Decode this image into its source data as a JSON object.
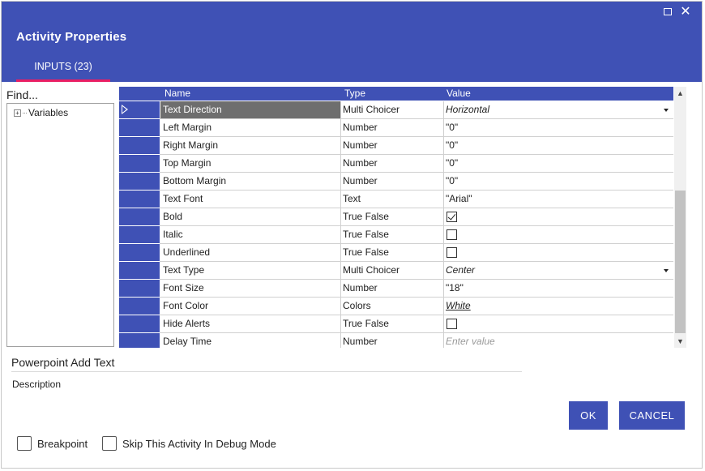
{
  "window": {
    "title": "Activity Properties",
    "maximize_icon": "maximize-icon",
    "close_icon": "close-icon",
    "close_glyph": "✕"
  },
  "tabs": [
    {
      "label": "INPUTS (23)",
      "active": true
    }
  ],
  "left_panel": {
    "find_label": "Find...",
    "tree": [
      {
        "label": "Variables",
        "expander": "+"
      }
    ]
  },
  "grid": {
    "headers": {
      "name": "Name",
      "type": "Type",
      "value": "Value"
    },
    "rows": [
      {
        "name": "Text Direction",
        "type": "Multi Choicer",
        "value": "Horizontal",
        "kind": "dropdown",
        "selected": true
      },
      {
        "name": "Left Margin",
        "type": "Number",
        "value": "\"0\"",
        "kind": "text"
      },
      {
        "name": "Right Margin",
        "type": "Number",
        "value": "\"0\"",
        "kind": "text"
      },
      {
        "name": "Top Margin",
        "type": "Number",
        "value": "\"0\"",
        "kind": "text"
      },
      {
        "name": "Bottom Margin",
        "type": "Number",
        "value": "\"0\"",
        "kind": "text"
      },
      {
        "name": "Text Font",
        "type": "Text",
        "value": "\"Arial\"",
        "kind": "text"
      },
      {
        "name": "Bold",
        "type": "True False",
        "checked": true,
        "kind": "checkbox"
      },
      {
        "name": "Italic",
        "type": "True False",
        "checked": false,
        "kind": "checkbox"
      },
      {
        "name": "Underlined",
        "type": "True False",
        "checked": false,
        "kind": "checkbox"
      },
      {
        "name": "Text Type",
        "type": "Multi Choicer",
        "value": "Center",
        "kind": "dropdown"
      },
      {
        "name": "Font Size",
        "type": "Number",
        "value": "\"18\"",
        "kind": "text"
      },
      {
        "name": "Font Color",
        "type": "Colors",
        "value": "White",
        "kind": "color"
      },
      {
        "name": "Hide Alerts",
        "type": "True False",
        "checked": false,
        "kind": "checkbox"
      },
      {
        "name": "Delay Time",
        "type": "Number",
        "placeholder": "Enter value",
        "kind": "placeholder"
      }
    ]
  },
  "activity": {
    "name": "Powerpoint Add Text",
    "description_label": "Description"
  },
  "buttons": {
    "ok": "OK",
    "cancel": "CANCEL"
  },
  "options": {
    "breakpoint": {
      "label": "Breakpoint",
      "checked": false
    },
    "skip_debug": {
      "label": "Skip This Activity In Debug Mode",
      "checked": false
    }
  },
  "colors": {
    "accent": "#3f51b5",
    "tab_underline": "#e91e63",
    "selected_cell": "#6e6e6e"
  }
}
